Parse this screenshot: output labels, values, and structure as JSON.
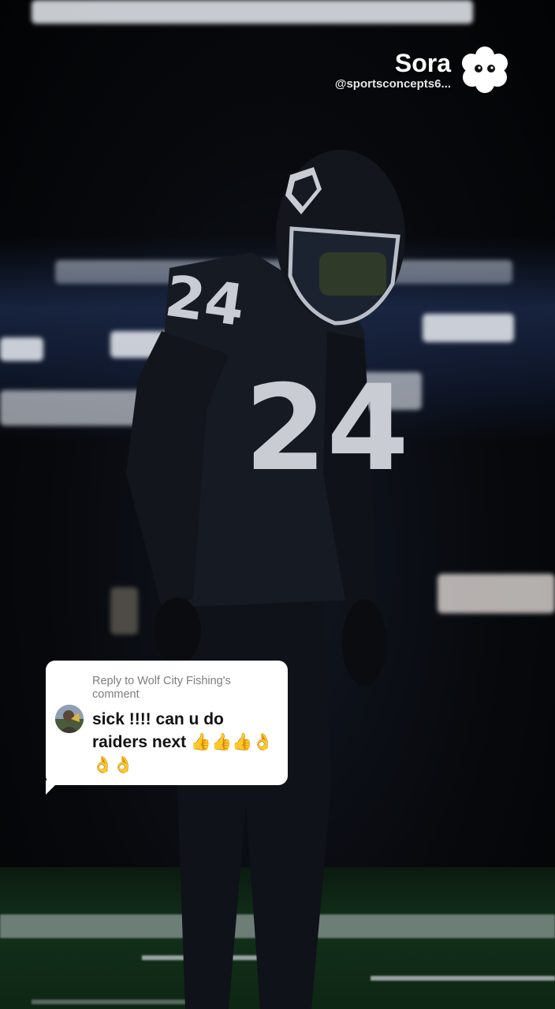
{
  "watermark": {
    "brand": "Sora",
    "handle": "@sportsconcepts6...",
    "logo_icon": "sora-cloud-icon"
  },
  "player": {
    "jersey_number": "24"
  },
  "reply": {
    "header": "Reply to Wolf City Fishing's comment",
    "text": "sick !!!! can u do raiders next 👍👍👍👌👌👌",
    "avatar_icon": "user-avatar"
  },
  "colors": {
    "card_bg": "#ffffff",
    "header_text": "#7d7d7d",
    "comment_text": "#111111",
    "uniform": "#161a22"
  }
}
